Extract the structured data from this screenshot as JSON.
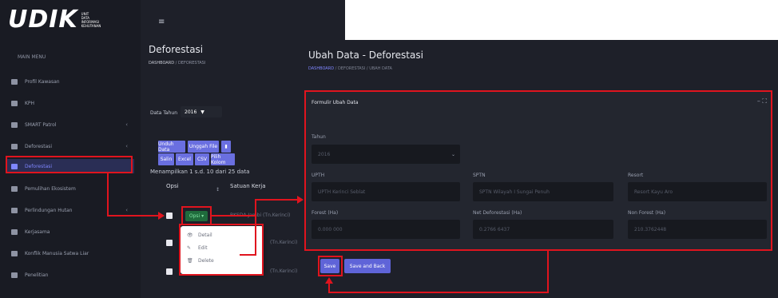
{
  "left": {
    "logo": {
      "big": "UDIK",
      "sub": [
        "UNIT",
        "DATA",
        "INFORMASI",
        "KEHUTANAN"
      ]
    },
    "nav_title": "MAIN MENU",
    "nav": [
      {
        "label": "Profil Kawasan"
      },
      {
        "label": "KPH"
      },
      {
        "label": "SMART Patrol",
        "chev": "‹"
      },
      {
        "label": "Deforestasi",
        "chev": "‹"
      },
      {
        "label": "Deforestasi",
        "active": true
      },
      {
        "label": "Pemulihan Ekosistem"
      },
      {
        "label": "Perlindungan Hutan",
        "chev": "‹"
      },
      {
        "label": "Kerjasama"
      },
      {
        "label": "Konflik Manusia Satwa Liar"
      },
      {
        "label": "Penelitian"
      }
    ],
    "page_title": "Deforestasi",
    "breadcrumb": [
      "DASHBOARD",
      "DEFORESTASI"
    ],
    "year_label": "Data Tahun",
    "year_value": "2016",
    "toolbar_row1": [
      "Unduh Data",
      "Unggah File"
    ],
    "toolbar_row2": [
      "Salin",
      "Excel",
      "CSV",
      "Pilih Kolom"
    ],
    "showing": "Menampilkan 1 s.d. 10 dari 25 data",
    "col_opsi": "Opsi",
    "col_sort": "↕",
    "col_satker": "Satuan Kerja",
    "opsi_button": "Opsi ▾",
    "rows": [
      "BKSDA Jambi (Tn.Kerinci)",
      "(Tn.Kerinci)",
      "(Tn.Kerinci)"
    ],
    "dropdown": [
      {
        "icon": "👁",
        "label": "Detail"
      },
      {
        "icon": "✎",
        "label": "Edit"
      },
      {
        "icon": "🗑",
        "label": "Delete"
      }
    ]
  },
  "right": {
    "title": "Ubah Data - Deforestasi",
    "breadcrumb": [
      "DASHBOARD",
      "DEFORESTASI",
      "UBAH DATA"
    ],
    "card_title": "Formulir Ubah Data",
    "card_tools": "– ⛶",
    "fields": {
      "tahun": {
        "label": "Tahun",
        "value": "2016"
      },
      "upth": {
        "label": "UPTH",
        "value": "UPTH Kerinci Seblat"
      },
      "satker": {
        "label": "SPTN",
        "value": "SPTN Wilayah I Sungai Penuh"
      },
      "resort": {
        "label": "Resort",
        "value": "Resort Kayu Aro"
      },
      "forest": {
        "label": "Forest (Ha)",
        "value": "0.000 000"
      },
      "net_defor": {
        "label": "Net Deforestasi (Ha)",
        "value": "0.2766 6437"
      },
      "non_forest": {
        "label": "Non Forest (Ha)",
        "value": "210.3762448"
      }
    },
    "save_label": "Save",
    "save_back_label": "Save and Back"
  },
  "colors": {
    "highlight": "#e0141e",
    "accent": "#6a6fe0",
    "panel": "#1e2029"
  }
}
